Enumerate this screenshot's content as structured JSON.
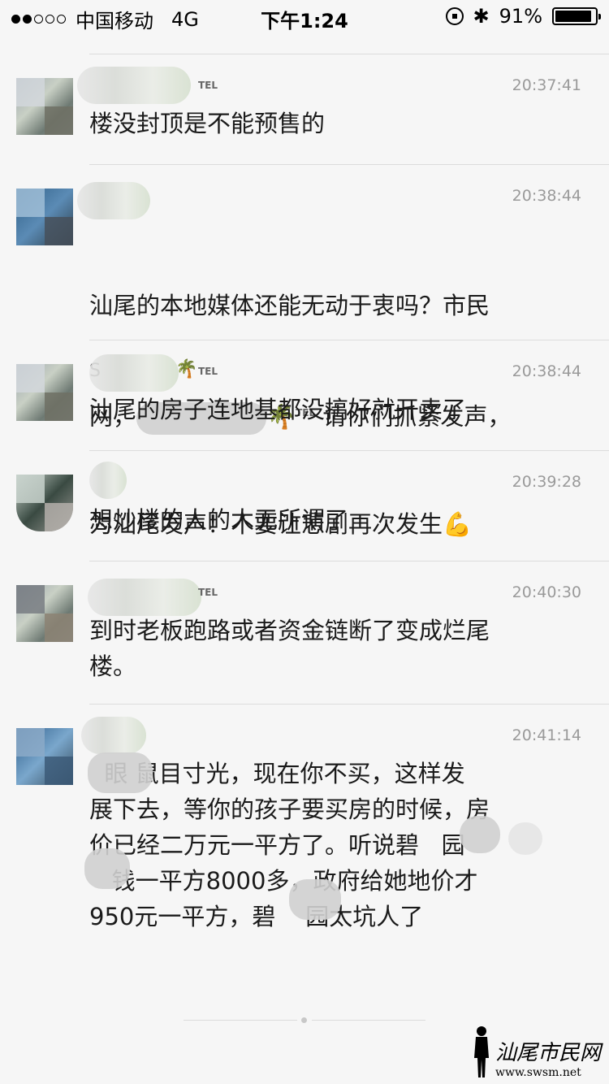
{
  "status_bar": {
    "signal_bars": [
      true,
      true,
      false,
      false,
      false
    ],
    "carrier": "中国移动",
    "network": "4G",
    "time": "下午1:24",
    "battery_percent": "91%",
    "battery_level": 0.91
  },
  "comments": [
    {
      "tel": "TEL",
      "time": "20:37:41",
      "text": "楼没封顶是不能预售的"
    },
    {
      "tel": "",
      "time": "20:38:44",
      "text_line1": "汕尾的本地媒体还能无动于衷吗？市民",
      "text_line2_a": "网，",
      "text_line2_emoji": "🌴",
      "text_line2_tel": "TEL",
      "text_line2_b": "请你们抓紧发声，",
      "text_line3": "为汕尾发声！不要让悲剧再次发生",
      "text_line3_emoji": "💪"
    },
    {
      "name_char": "S",
      "emoji": "🌴",
      "tel": "TEL",
      "time": "20:38:44",
      "text": "汕尾的房子连地基都没搞好就开卖了"
    },
    {
      "tel": "",
      "time": "20:39:28",
      "text": "想炒楼的人的人无所谓了"
    },
    {
      "tel": "TEL",
      "time": "20:40:30",
      "text": "到时老板跑路或者资金链断了变成烂尾\n楼。"
    },
    {
      "tel": "",
      "time": "20:41:14",
      "text": "  眼 鼠目寸光，现在你不买，这样发\n展下去，等你的孩子要买房的时候，房\n价已经二万元一平方了。听说碧   园\n   钱一平方8000多，政府给她地价才\n950元一平方，碧    园太坑人了"
    }
  ],
  "watermark": {
    "name": "汕尾市民网",
    "url": "www.swsm.net"
  }
}
